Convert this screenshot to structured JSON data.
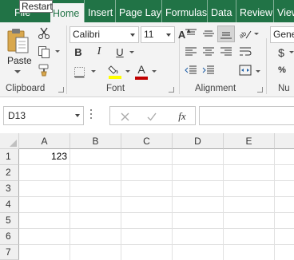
{
  "tooltip": "Restart",
  "tabs": [
    {
      "label": "File"
    },
    {
      "label": "Home"
    },
    {
      "label": "Insert"
    },
    {
      "label": "Page Layo"
    },
    {
      "label": "Formulas"
    },
    {
      "label": "Data"
    },
    {
      "label": "Review"
    },
    {
      "label": "View"
    }
  ],
  "ribbon": {
    "clipboard": {
      "paste_label": "Paste",
      "group_label": "Clipboard"
    },
    "font": {
      "font_name": "Calibri",
      "font_size": "11",
      "group_label": "Font",
      "bold": "B",
      "italic": "I",
      "underline": "U",
      "font_color_letter": "A",
      "grow_letter": "A",
      "shrink_letter": "A"
    },
    "alignment": {
      "group_label": "Alignment"
    },
    "number": {
      "format": "Gene",
      "group_label": "Nu",
      "currency": "$"
    }
  },
  "colors": {
    "accent": "#217346",
    "highlight": "#ffff00",
    "font_color": "#c00000"
  },
  "formula_bar": {
    "name_box": "D13",
    "fx": "fx",
    "value": ""
  },
  "grid": {
    "columns": [
      "A",
      "B",
      "C",
      "D",
      "E"
    ],
    "rows": [
      "1",
      "2",
      "3",
      "4",
      "5",
      "6",
      "7"
    ],
    "cells": {
      "A1": "123"
    }
  }
}
